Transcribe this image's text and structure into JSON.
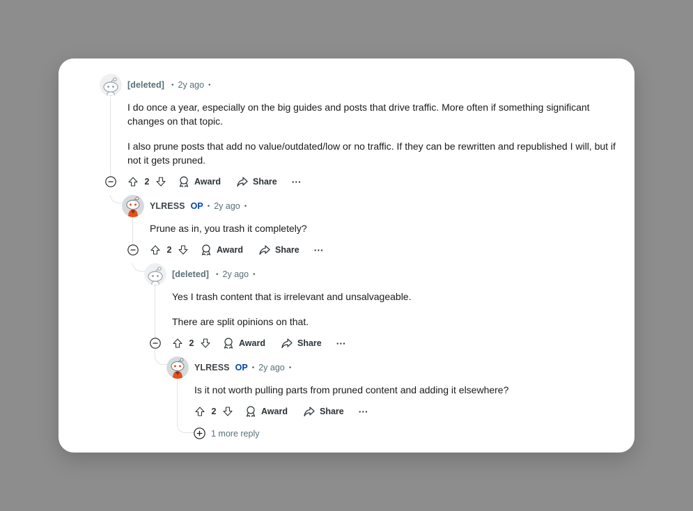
{
  "comments": [
    {
      "author": "[deleted]",
      "op_badge": "",
      "dot1": "•",
      "time": "2y ago",
      "dot2": "•",
      "paragraphs": [
        "I do once a year, especially on the big guides and posts that drive traffic. More often if something significant changes on that topic.",
        "I also prune posts that add no value/outdated/low or no traffic. If they can be rewritten and republished I will, but if not it gets pruned."
      ],
      "score": "2",
      "award_label": "Award",
      "share_label": "Share",
      "more_label": "···"
    },
    {
      "author": "YLRESS",
      "op_badge": "OP",
      "dot1": "•",
      "time": "2y ago",
      "dot2": "•",
      "paragraphs": [
        "Prune as in, you trash it completely?"
      ],
      "score": "2",
      "award_label": "Award",
      "share_label": "Share",
      "more_label": "···"
    },
    {
      "author": "[deleted]",
      "op_badge": "",
      "dot1": "•",
      "time": "2y ago",
      "dot2": "•",
      "paragraphs": [
        "Yes I trash content that is irrelevant and unsalvageable.",
        "There are split opinions on that."
      ],
      "score": "2",
      "award_label": "Award",
      "share_label": "Share",
      "more_label": "···"
    },
    {
      "author": "YLRESS",
      "op_badge": "OP",
      "dot1": "•",
      "time": "2y ago",
      "dot2": "•",
      "paragraphs": [
        "Is it not worth pulling parts from pruned content and adding it elsewhere?"
      ],
      "score": "2",
      "award_label": "Award",
      "share_label": "Share",
      "more_label": "···"
    }
  ],
  "more_replies_label": "1 more reply",
  "colors": {
    "background": "#8d8d8d",
    "card": "#ffffff",
    "op_badge": "#0045ac",
    "meta_text": "#576f76",
    "thread_line": "#e1e3e5",
    "avatar_orange": "#e4501c"
  },
  "icons": [
    "upvote-icon",
    "downvote-icon",
    "award-icon",
    "share-icon",
    "collapse-icon",
    "expand-icon",
    "avatar-snoo"
  ]
}
